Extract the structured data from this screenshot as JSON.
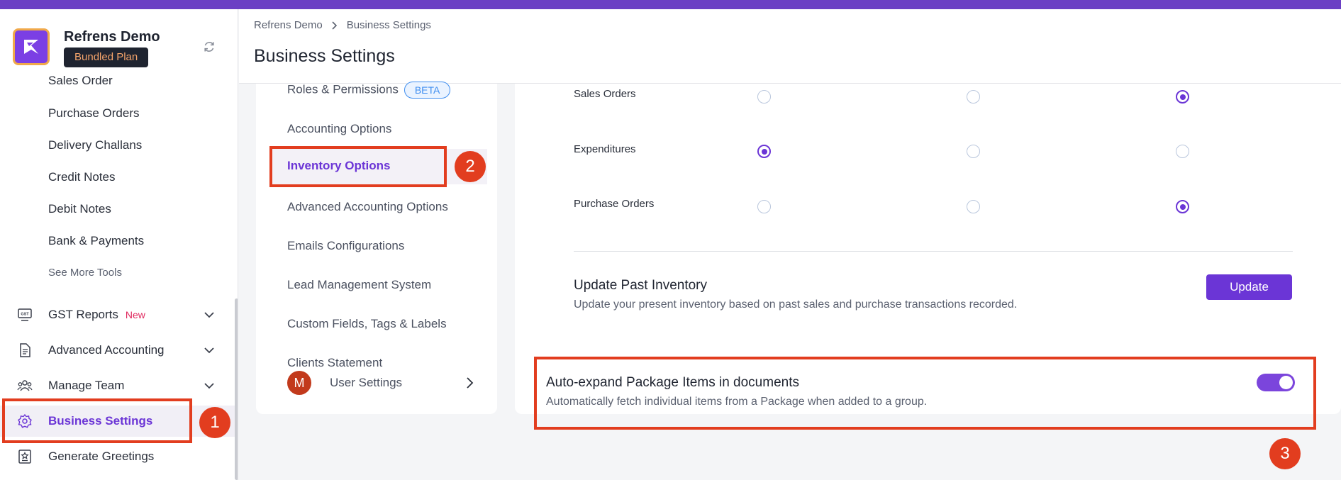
{
  "colors": {
    "accent": "#6b35d6",
    "topbar": "#6b3fc4",
    "annotation": "#e23d1f",
    "plan_badge_text": "#f5a46b"
  },
  "app": {
    "name": "Refrens Demo",
    "plan": "Bundled Plan",
    "logo_icon": "refrens-logo-icon",
    "sync_icon": "refresh-icon"
  },
  "sidebar": {
    "sub_items": [
      "Sales Order",
      "Purchase Orders",
      "Delivery Challans",
      "Credit Notes",
      "Debit Notes",
      "Bank & Payments"
    ],
    "see_more": "See More Tools",
    "main_items": [
      {
        "label": "GST Reports",
        "tag": "New",
        "icon": "gst-icon",
        "expandable": true
      },
      {
        "label": "Advanced Accounting",
        "tag": "",
        "icon": "document-icon",
        "expandable": true
      },
      {
        "label": "Manage Team",
        "tag": "",
        "icon": "team-icon",
        "expandable": true
      },
      {
        "label": "Business Settings",
        "tag": "",
        "icon": "gear-icon",
        "expandable": false,
        "active": true
      },
      {
        "label": "Generate Greetings",
        "tag": "",
        "icon": "greeting-card-icon",
        "expandable": false
      }
    ]
  },
  "header": {
    "breadcrumb": [
      "Refrens Demo",
      "Business Settings"
    ],
    "title": "Business Settings"
  },
  "settings_nav": {
    "items": [
      "Roles & Permissions",
      "Accounting Options",
      "Inventory Options",
      "Advanced Accounting Options",
      "Emails Configurations",
      "Lead Management System",
      "Custom Fields, Tags & Labels",
      "Clients Statement"
    ],
    "beta_label": "BETA",
    "active": "Inventory Options",
    "user": {
      "avatar_letter": "M",
      "label": "User Settings"
    }
  },
  "inventory": {
    "rows": [
      {
        "label": "Sales Orders",
        "selected": 3
      },
      {
        "label": "Expenditures",
        "selected": 1
      },
      {
        "label": "Purchase Orders",
        "selected": 3
      }
    ],
    "update_past": {
      "title": "Update Past Inventory",
      "description": "Update your present inventory based on past sales and purchase transactions recorded.",
      "button": "Update"
    },
    "auto_expand": {
      "title": "Auto-expand Package Items in documents",
      "description": "Automatically fetch individual items from a Package when added to a group.",
      "enabled": true
    }
  },
  "annotations": [
    "1",
    "2",
    "3"
  ]
}
